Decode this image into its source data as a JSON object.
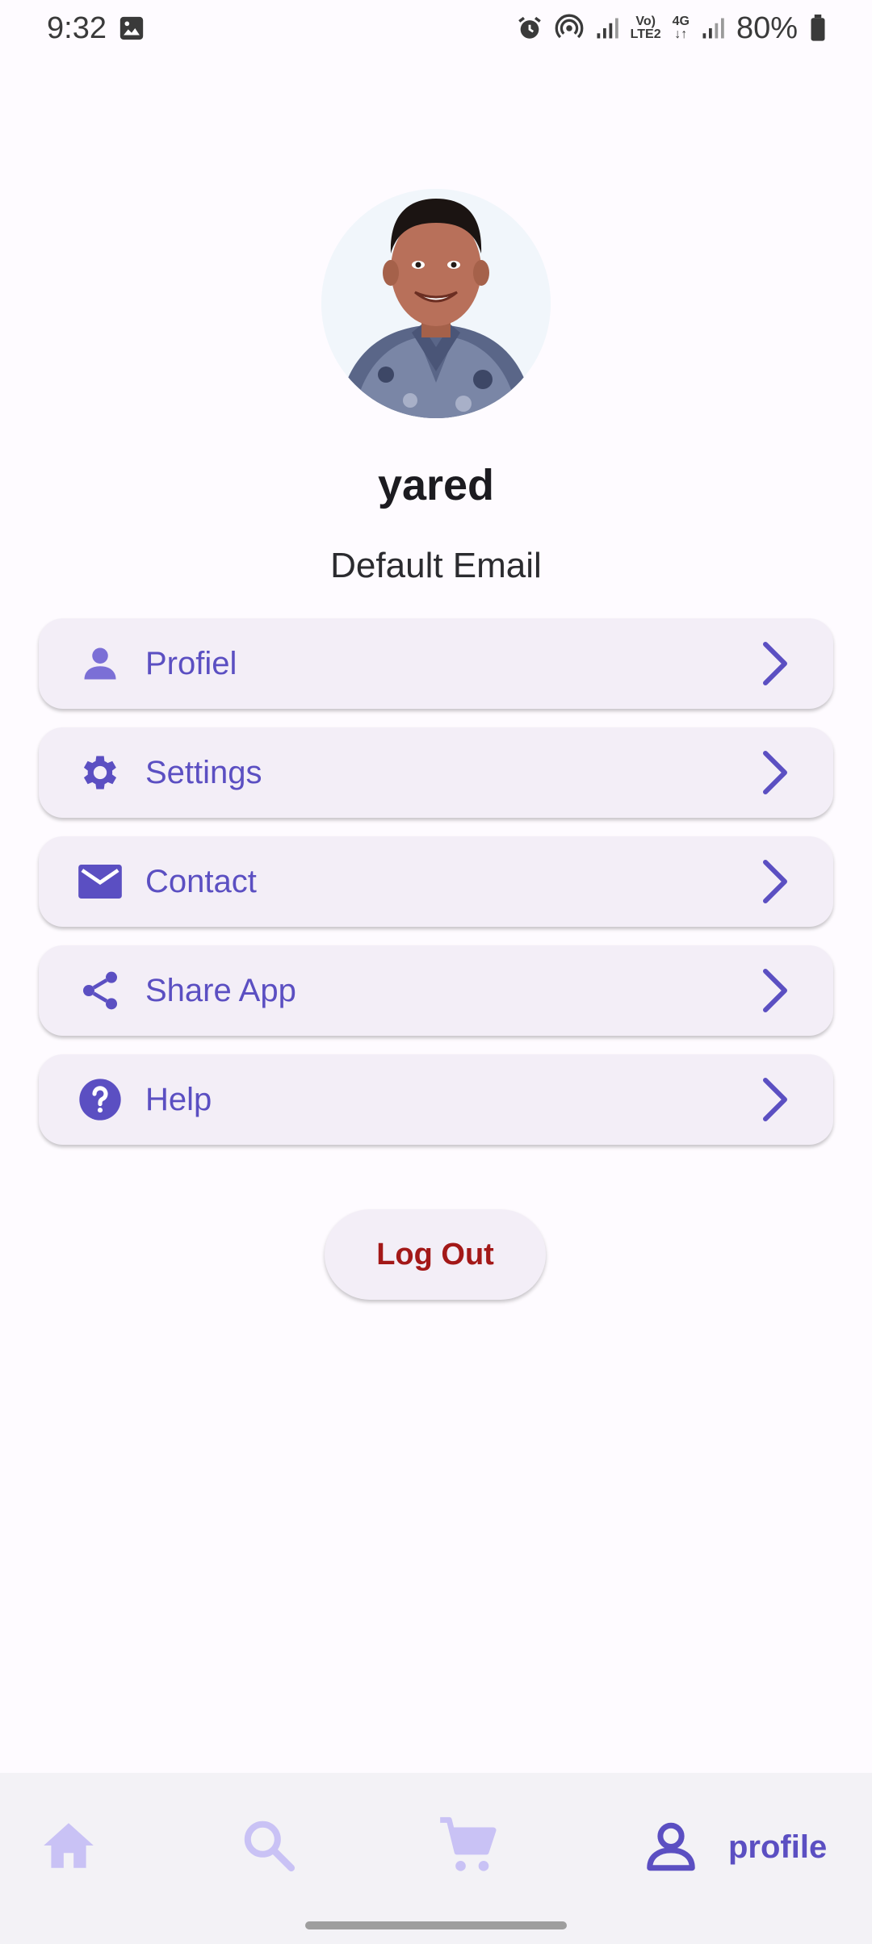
{
  "status_bar": {
    "time": "9:32",
    "battery": "80%",
    "volte": "Vo)",
    "lte": "LTE2",
    "network": "4G",
    "icons": [
      "image-icon",
      "alarm-icon",
      "hotspot-icon",
      "signal-icon",
      "signal-icon",
      "battery-icon"
    ]
  },
  "profile": {
    "name": "yared",
    "email": "Default Email"
  },
  "menu": {
    "items": [
      {
        "label": "Profiel",
        "icon": "person-icon"
      },
      {
        "label": "Settings",
        "icon": "gear-icon"
      },
      {
        "label": "Contact",
        "icon": "mail-icon"
      },
      {
        "label": "Share App",
        "icon": "share-icon"
      },
      {
        "label": "Help",
        "icon": "help-icon"
      }
    ]
  },
  "logout_label": "Log Out",
  "bottom_nav": {
    "items": [
      {
        "icon": "home-icon",
        "label": ""
      },
      {
        "icon": "search-icon",
        "label": ""
      },
      {
        "icon": "cart-icon",
        "label": ""
      },
      {
        "icon": "profile-icon",
        "label": "profile"
      }
    ],
    "active_index": 3
  },
  "colors": {
    "accent": "#5b4fc2",
    "accent_light": "#c9c2f5",
    "card": "#f3eef7",
    "logout_text": "#a31818"
  }
}
